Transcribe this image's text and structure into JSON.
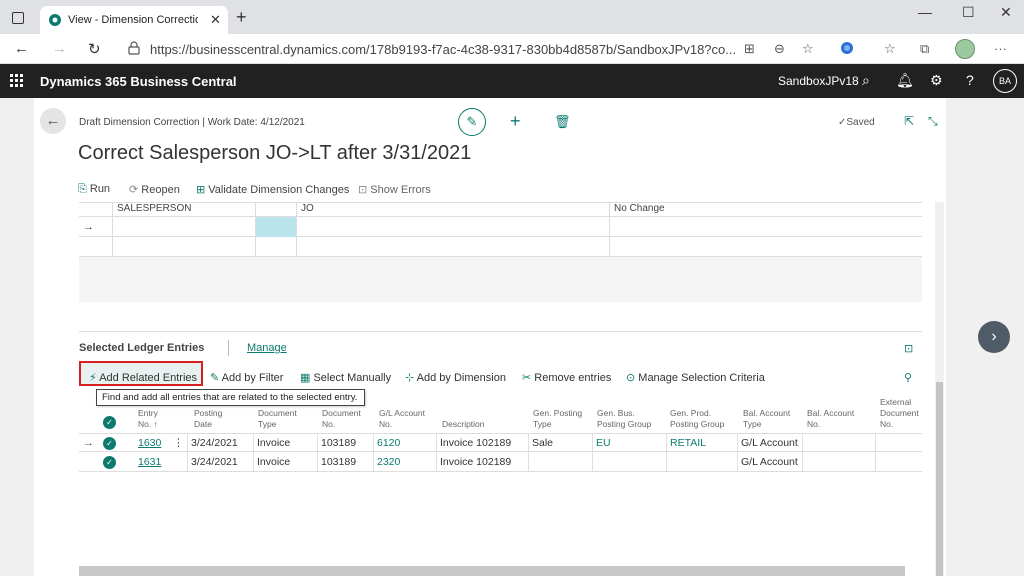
{
  "browser": {
    "tab_title": "View - Dimension Corrections - D",
    "tab_close": "✕",
    "new_tab": "+",
    "url": "https://businesscentral.dynamics.com/178b9193-f7ac-4c38-9317-830bb4d8587b/SandboxJPv18?co...",
    "window_controls": [
      "—",
      "☐",
      "✕"
    ]
  },
  "app": {
    "name": "Dynamics 365 Business Central",
    "environment": "SandboxJPv18",
    "user_initials": "BA"
  },
  "page": {
    "breadcrumb": "Draft Dimension Correction | Work Date: 4/12/2021",
    "title": "Correct Salesperson JO->LT after 3/31/2021",
    "saved": "Saved"
  },
  "actions": {
    "run": "Run",
    "reopen": "Reopen",
    "validate": "Validate Dimension Changes",
    "show_errors": "Show Errors"
  },
  "dimension_grid": {
    "row": {
      "dimension": "SALESPERSON",
      "value": "JO",
      "new_value": "No Change"
    },
    "arrow": "→"
  },
  "section": {
    "title": "Selected Ledger Entries",
    "manage": "Manage"
  },
  "section_actions": {
    "add_related": "Add Related Entries",
    "add_by_filter": "Add by Filter",
    "select_manually": "Select Manually",
    "add_by_dimension": "Add by Dimension",
    "remove_entries": "Remove entries",
    "manage_selection": "Manage Selection Criteria"
  },
  "tooltip": "Find and add all entries that are related to the selected entry.",
  "table": {
    "headers": [
      "Entry\nNo. ↑",
      "Posting\nDate",
      "Document\nType",
      "Document\nNo.",
      "G/L Account\nNo.",
      "Description",
      "Gen. Posting\nType",
      "Gen. Bus.\nPosting Group",
      "Gen. Prod.\nPosting Group",
      "Bal. Account\nType",
      "Bal. Account\nNo.",
      "External\nDocument\nNo."
    ],
    "rows": [
      {
        "entry_no": "1630",
        "posting_date": "3/24/2021",
        "doc_type": "Invoice",
        "doc_no": "103189",
        "gl_account": "6120",
        "description": "Invoice 102189",
        "gen_posting_type": "Sale",
        "gen_bus": "EU",
        "gen_prod": "RETAIL",
        "bal_type": "G/L Account",
        "bal_no": "",
        "ext_doc": ""
      },
      {
        "entry_no": "1631",
        "posting_date": "3/24/2021",
        "doc_type": "Invoice",
        "doc_no": "103189",
        "gl_account": "2320",
        "description": "Invoice 102189",
        "gen_posting_type": "",
        "gen_bus": "",
        "gen_prod": "",
        "bal_type": "G/L Account",
        "bal_no": "",
        "ext_doc": ""
      }
    ],
    "check": "✓",
    "row_menu": "⋮",
    "row_arrow": "→"
  },
  "colors": {
    "accent": "#0d7a6f",
    "header_bg": "#212121",
    "highlight_border": "#d42020"
  }
}
